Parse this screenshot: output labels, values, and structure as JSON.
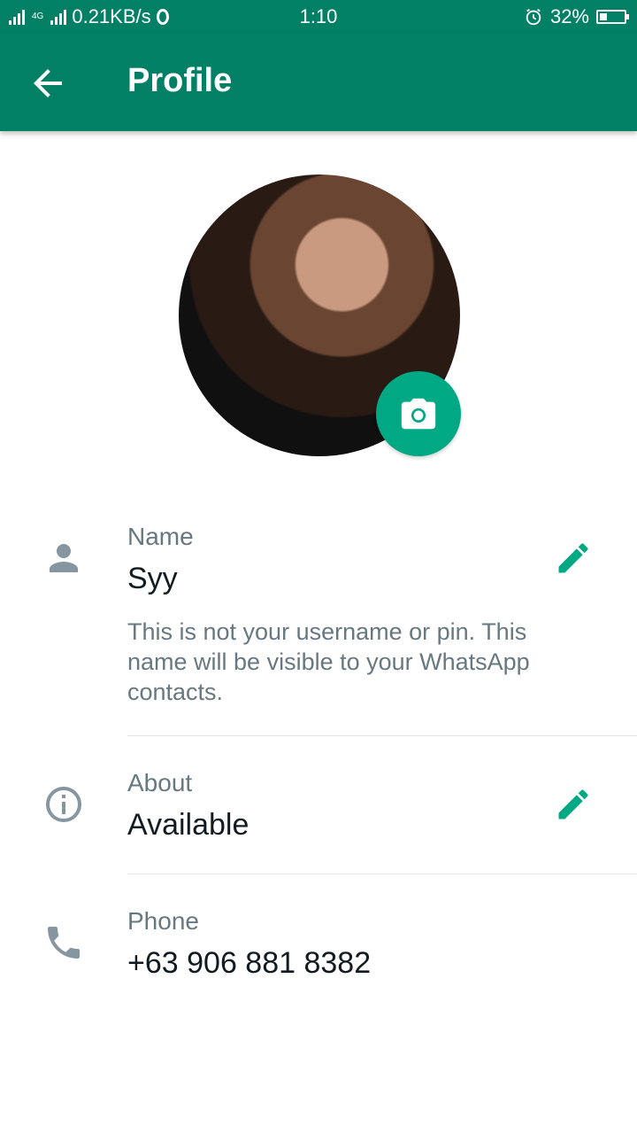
{
  "status_bar": {
    "network_type": "4G",
    "data_speed": "0.21KB/s",
    "time": "1:10",
    "battery_percent": "32%",
    "battery_level": 0.32,
    "icons": [
      "signal-icon",
      "opera-icon",
      "alarm-icon",
      "battery-icon"
    ]
  },
  "app_bar": {
    "title": "Profile",
    "back_icon": "arrow-left-icon",
    "color": "#018066"
  },
  "avatar": {
    "camera_icon": "camera-icon",
    "accent": "#00a884"
  },
  "name_section": {
    "label": "Name",
    "value": "Syy",
    "hint": "This is not your username or pin. This name will be visible to your WhatsApp contacts.",
    "icon": "person-icon",
    "edit_icon": "pencil-icon"
  },
  "about_section": {
    "label": "About",
    "value": "Available",
    "icon": "info-icon",
    "edit_icon": "pencil-icon"
  },
  "phone_section": {
    "label": "Phone",
    "value": "+63 906 881 8382",
    "icon": "phone-icon"
  }
}
